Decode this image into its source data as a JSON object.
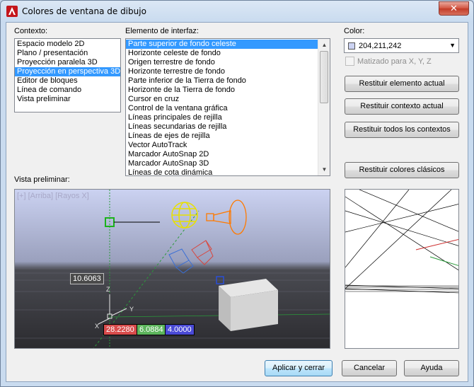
{
  "window": {
    "title": "Colores de ventana de dibujo",
    "close_glyph": "✕"
  },
  "context": {
    "label": "Contexto:",
    "items": [
      {
        "label": "Espacio modelo 2D"
      },
      {
        "label": "Plano / presentación"
      },
      {
        "label": "Proyección paralela 3D"
      },
      {
        "label": "Proyección en perspectiva 3D",
        "selected": true
      },
      {
        "label": "Editor de bloques"
      },
      {
        "label": "Línea de comando"
      },
      {
        "label": "Vista preliminar"
      }
    ]
  },
  "interface_element": {
    "label": "Elemento de interfaz:",
    "items": [
      {
        "label": "Parte superior de fondo celeste",
        "selected": true
      },
      {
        "label": "Horizonte celeste de fondo"
      },
      {
        "label": "Origen terrestre de fondo"
      },
      {
        "label": "Horizonte terrestre de fondo"
      },
      {
        "label": "Parte inferior de la Tierra de fondo"
      },
      {
        "label": "Horizonte de la Tierra de fondo"
      },
      {
        "label": "Cursor en cruz"
      },
      {
        "label": "Control de la ventana gráfica"
      },
      {
        "label": "Líneas principales de rejilla"
      },
      {
        "label": "Líneas secundarias de rejilla"
      },
      {
        "label": "Líneas de ejes de rejilla"
      },
      {
        "label": "Vector AutoTrack"
      },
      {
        "label": "Marcador AutoSnap 2D"
      },
      {
        "label": "Marcador AutoSnap 3D"
      },
      {
        "label": "Líneas de cota dinámica"
      }
    ]
  },
  "color": {
    "label": "Color:",
    "value": "204,211,242",
    "swatch_color": "#ccd3f2",
    "tint_label": "Matizado para X, Y, Z"
  },
  "buttons": {
    "restore_element": "Restituir elemento actual",
    "restore_context": "Restituir contexto actual",
    "restore_all": "Restituir todos los contextos",
    "restore_classic": "Restituir colores clásicos",
    "apply_close": "Aplicar y cerrar",
    "cancel": "Cancelar",
    "help": "Ayuda"
  },
  "preview": {
    "label": "Vista preliminar:",
    "viewport_label": "[+] [Arriba] [Rayos X]",
    "dimensions": {
      "length": "10.6063",
      "x": "28.2280",
      "y": "6.0884",
      "z": "4.0000"
    },
    "axis_labels": {
      "z": "Z",
      "y": "Y",
      "x": "X"
    }
  }
}
